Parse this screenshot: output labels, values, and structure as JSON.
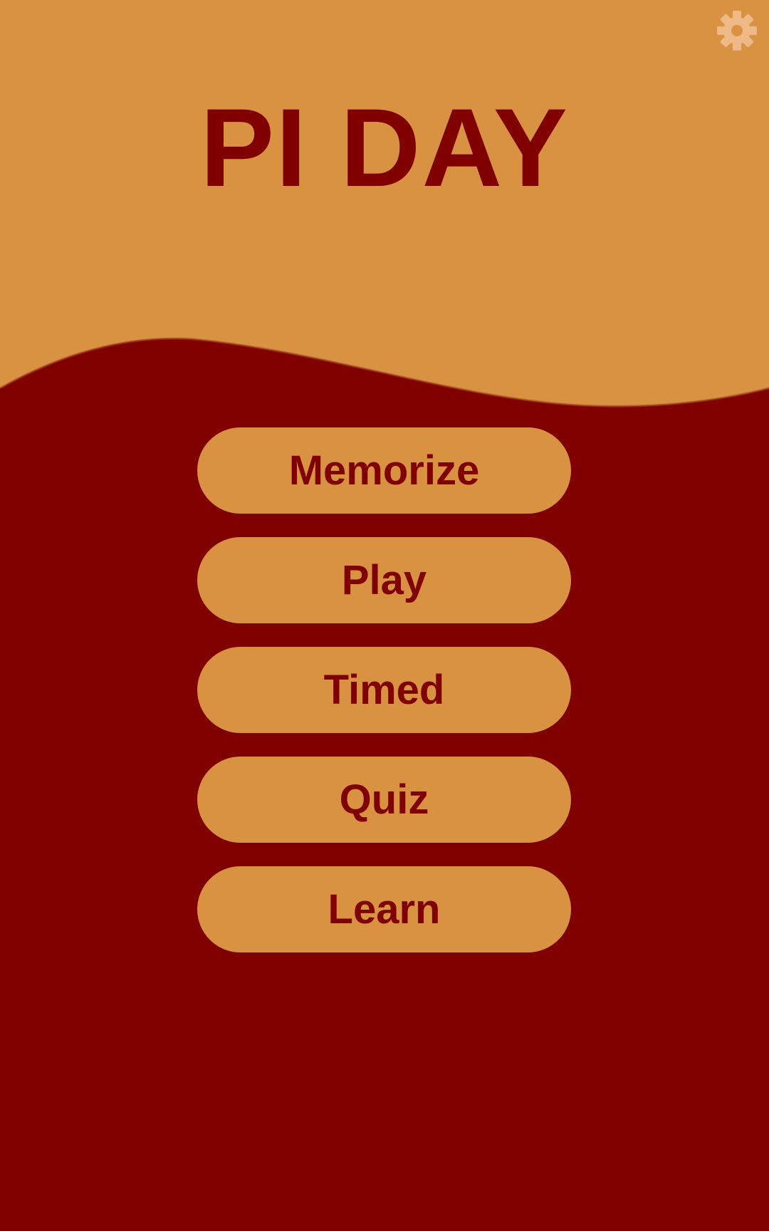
{
  "app": {
    "title": "PI DAY"
  },
  "colors": {
    "header": "#D99241",
    "background": "#800000",
    "button": "#D99241",
    "button_text": "#800000",
    "gear_icon": "#EFB887"
  },
  "toolbar": {
    "settings_icon": "gear-icon"
  },
  "menu": {
    "items": [
      {
        "label": "Memorize"
      },
      {
        "label": "Play"
      },
      {
        "label": "Timed"
      },
      {
        "label": "Quiz"
      },
      {
        "label": "Learn"
      }
    ]
  }
}
